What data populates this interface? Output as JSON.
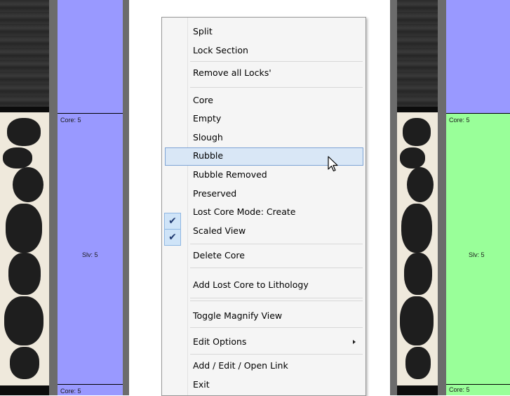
{
  "window": {
    "background": "#ffffff"
  },
  "left_panel": {
    "colors": {
      "section_blue": "#9999ff",
      "separator": "#000000",
      "gutter": "#6c6c6c"
    },
    "labels": {
      "core_top": "Core: 5",
      "middle": "Slv: 5",
      "core_bottom": "Core: 5"
    }
  },
  "right_panel": {
    "colors": {
      "section_blue": "#9999ff",
      "section_green": "#99ff99",
      "separator": "#000000"
    },
    "labels": {
      "core_top": "Core: 5",
      "middle": "Slv: 5",
      "core_bottom": "Core: 5"
    }
  },
  "context_menu": {
    "items": [
      {
        "label": "Split"
      },
      {
        "label": "Lock Section"
      },
      {
        "label": "Remove all Locks'"
      },
      {
        "label": "Core"
      },
      {
        "label": "Empty"
      },
      {
        "label": "Slough"
      },
      {
        "label": "Rubble"
      },
      {
        "label": "Rubble Removed"
      },
      {
        "label": "Preserved"
      },
      {
        "label": "Lost Core Mode: Create",
        "checked": true
      },
      {
        "label": "Scaled View",
        "checked": true
      },
      {
        "label": "Delete Core"
      },
      {
        "label": "Add Lost Core to Lithology"
      },
      {
        "label": "Toggle Magnify View"
      },
      {
        "label": "Edit Options",
        "has_submenu": true
      },
      {
        "label": "Add / Edit / Open Link"
      },
      {
        "label": "Exit"
      }
    ],
    "highlighted_item": "Rubble",
    "check_glyph": "✔",
    "colors": {
      "highlight_bg": "#d9e7f6",
      "highlight_border": "#7ea4d5",
      "menu_bg": "#f5f5f5"
    }
  },
  "icons": {
    "pointer": "mouse-pointer-icon",
    "submenu": "submenu-arrow-icon",
    "check": "checkmark-icon"
  }
}
